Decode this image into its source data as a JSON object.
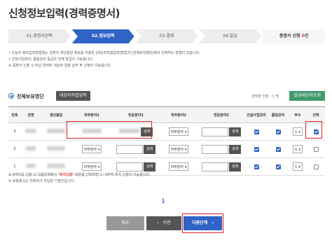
{
  "page": {
    "title": "신청정보입력(경력증명서)"
  },
  "steps": [
    {
      "label": "01.증명서선택"
    },
    {
      "label": "02.정보입력"
    },
    {
      "label": "03.결제"
    },
    {
      "label": "04.발급"
    }
  ],
  "request_count": {
    "prefix": "증명서 신청 ",
    "count": "0",
    "suffix": "건"
  },
  "notes": [
    "• 다상자 정보입력방법에는 성명과 생년월일 정보를 이용한 [대상자직접입력]방법과 [전체보유명단]에서 선택하는 방법이 있습니다.",
    "• 건설사업관리, 품질관리 등급은 전체 발급이 가능합니다.",
    "※ 증명서 신청 시 미납 연회비 대상자 일괄 납부 후 신청이 가능합니다."
  ],
  "section": {
    "title": "전체보유명단",
    "direct_input_button": "대상자직접입력",
    "selection_info": "선택된 인원 : 1 명",
    "lookup_button": "발급대상자조회"
  },
  "table": {
    "headers": [
      "번호",
      "성명",
      "생년월일",
      "직무분야1",
      "전문분야1",
      "직무분야2",
      "전문분야2",
      "건설사업관리",
      "품질관리",
      "부수",
      "선택"
    ],
    "rows": [
      {
        "no": "3",
        "job1": "",
        "job2": "직무분야",
        "search1": "검색",
        "search2": "검색",
        "cm": true,
        "qm": true,
        "copies": "1",
        "selected": true
      },
      {
        "no": "2",
        "job1": "직무분야",
        "job2": "직무분야",
        "search1": "검색",
        "search2": "검색",
        "cm": true,
        "qm": true,
        "copies": "1",
        "selected": false
      },
      {
        "no": "1",
        "job1": "직무분야",
        "job2": "직무분야",
        "search1": "검색",
        "search2": "검색",
        "cm": true,
        "qm": true,
        "copies": "1",
        "selected": false
      }
    ]
  },
  "footnotes": {
    "line1_prefix": "※ 4부이상 신청 시 다음단계에서 \"",
    "line1_highlight": "추가신청",
    "line1_suffix": "\" 버튼을 선택하면 1~3부씩 추가 신청이 가능합니다.",
    "line2": "※ 응용표시는 연회비가 미납된 기술인입니다."
  },
  "pagination": {
    "current": "1"
  },
  "buttons": {
    "cancel": "취소",
    "prev": "이전",
    "next": "다음단계"
  },
  "colors": {
    "primary": "#2f63c5",
    "highlight": "#e02020",
    "green": "#3f9a6c"
  }
}
